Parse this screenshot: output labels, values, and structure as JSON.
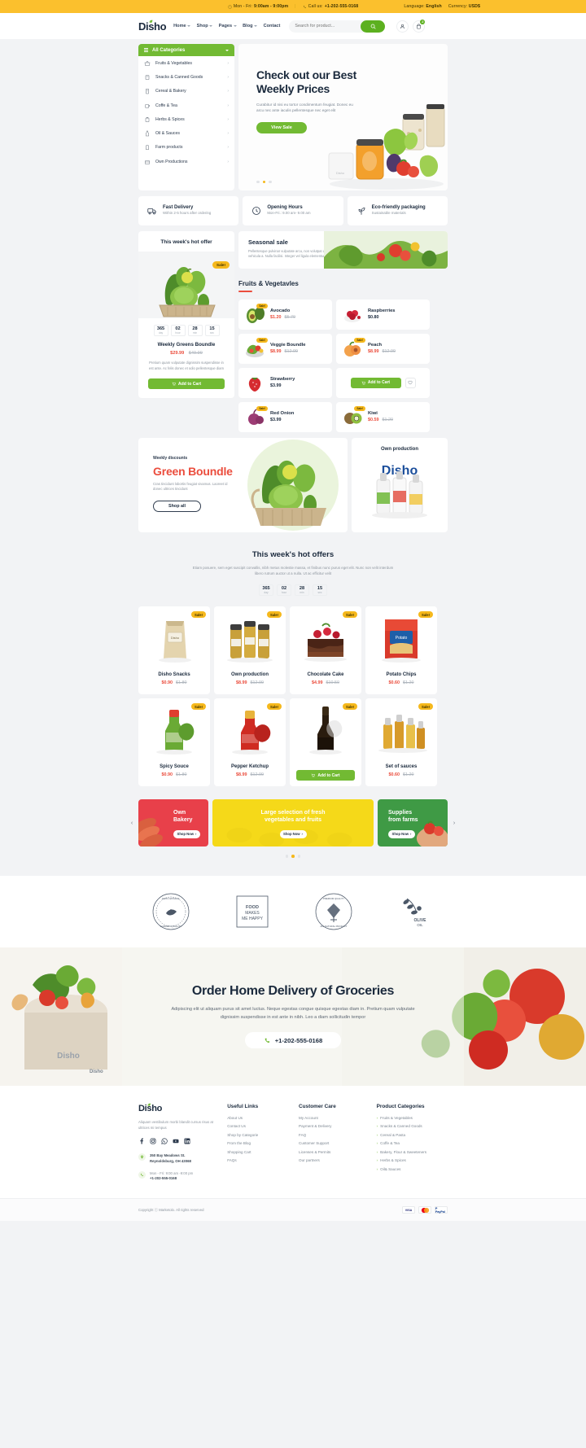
{
  "topbar": {
    "hours_label": "Mon - Fri:",
    "hours_value": "9:00am - 9:00pm",
    "call_label": "Call us:",
    "call_value": "+1-202-555-0168",
    "language_label": "Language:",
    "language_value": "English",
    "currency_label": "Currency:",
    "currency_value": "USD$"
  },
  "header": {
    "logo": "Disho",
    "nav": [
      {
        "label": "Home",
        "has_dropdown": true
      },
      {
        "label": "Shop",
        "has_dropdown": true
      },
      {
        "label": "Pages",
        "has_dropdown": true
      },
      {
        "label": "Blog",
        "has_dropdown": true
      },
      {
        "label": "Contact",
        "has_dropdown": false
      }
    ],
    "search_placeholder": "Search for product...",
    "cart_count": "2"
  },
  "categories": {
    "title": "All Categories",
    "items": [
      "Fruits & Vegetables",
      "Snacks & Canned Goods",
      "Cereal & Bakery",
      "Coffe & Tea",
      "Herbs & Spices",
      "Oil & Sauces",
      "Farm products",
      "Own Productions"
    ]
  },
  "hero": {
    "title_line1": "Check out our Best",
    "title_line2": "Weekly Prices",
    "desc": "Curabitur id nisi eu tortor condimentum feugiat. Donec eu arcu nec ante iaculis pellentesque nec eget elit",
    "button": "View Sale"
  },
  "features": [
    {
      "title": "Fast Delivery",
      "desc": "Within 2-5 hours after ordering",
      "icon": "truck-icon"
    },
    {
      "title": "Opening Hours",
      "desc": "Mon-Fri.: 9.00 am- 9.00 am",
      "icon": "clock-icon"
    },
    {
      "title": "Eco-friendly packaging",
      "desc": "Sustainable materials",
      "icon": "leaf-icon"
    }
  ],
  "hot_offer": {
    "heading": "This week's hot offer",
    "sale_badge": "Sale!",
    "timer": [
      {
        "value": "365",
        "unit": "day"
      },
      {
        "value": "02",
        "unit": "hour"
      },
      {
        "value": "28",
        "unit": "min"
      },
      {
        "value": "15",
        "unit": "sec"
      }
    ],
    "name": "Weekly Greens Boundle",
    "price_new": "$29.99",
    "price_old": "$49.99",
    "desc": "Pretium quam vulputate dignissim suspendisse in est ante. Ac felis donec et odio pellentesque diam",
    "cart_button": "Add to Cart"
  },
  "seasonal": {
    "title": "Seasonal sale",
    "desc": "Pellentesque pulvinar vulputate arcu, non volutpat dolor vehicula a. Nulla facilisi. Integer vel ligula elementum"
  },
  "fruits_section": {
    "title": "Fruits & Vegetavles",
    "products": [
      {
        "name": "Avocado",
        "price_new": "$1.20",
        "price_old": "$5.79",
        "sale": true
      },
      {
        "name": "Raspberries",
        "price_new": "$0.80",
        "price_old": "",
        "sale": false
      },
      {
        "name": "Veggie Boundle",
        "price_new": "$8.99",
        "price_old": "$12.99",
        "sale": true
      },
      {
        "name": "Peach",
        "price_new": "$8.99",
        "price_old": "$12.99",
        "sale": true
      },
      {
        "name": "Strawberry",
        "price_new": "$3.99",
        "price_old": "",
        "sale": false
      },
      {
        "name": "Red Onion",
        "price_new": "$3.99",
        "price_old": "",
        "sale": true
      },
      {
        "name": "Kiwi",
        "price_new": "$0.59",
        "price_old": "$1.20",
        "sale": true
      }
    ],
    "cart_button": "Add to Cart"
  },
  "bundle_banner": {
    "kicker": "Weekly discounts",
    "title": "Green Boundle",
    "desc": "Cras tincidunt lobortis feugiat vivamus. Laoreet id donec ultrices tincidunt",
    "button": "Shop all"
  },
  "own_production": {
    "title": "Own production",
    "brand": "Disho"
  },
  "hot_offers": {
    "title": "This week's hot offers",
    "desc": "Etiam posuere, sem eget suscipit convallis, nibh metus molestie massa, et finibus nunc purus eget elit. Nunc non velit interdum libero rutrum auctor ut a nulla. Ut ac efficitur velit",
    "timer": [
      {
        "value": "365",
        "unit": "day"
      },
      {
        "value": "02",
        "unit": "hour"
      },
      {
        "value": "28",
        "unit": "min"
      },
      {
        "value": "15",
        "unit": "sec"
      }
    ],
    "sale_badge": "Sale!",
    "cart_button": "Add to Cart",
    "products": [
      {
        "name": "Disho Snacks",
        "price_new": "$0.90",
        "price_old": "$1.80",
        "accent": "#e8c98c"
      },
      {
        "name": "Own production",
        "price_new": "$8.99",
        "price_old": "$12.99",
        "accent": "#c9a84c"
      },
      {
        "name": "Chocolate Cake",
        "price_new": "$4.99",
        "price_old": "$10.50",
        "accent": "#7a3b2a"
      },
      {
        "name": "Potato Chips",
        "price_new": "$0.60",
        "price_old": "$1.20",
        "accent": "#d93a2b"
      },
      {
        "name": "Spicy Souce",
        "price_new": "$0.90",
        "price_old": "$1.80",
        "accent": "#6aa33a"
      },
      {
        "name": "Pepper Ketchup",
        "price_new": "$8.99",
        "price_old": "$12.99",
        "accent": "#cf2b22"
      },
      {
        "name": "",
        "price_new": "",
        "price_old": "",
        "accent": "#3a2a16"
      },
      {
        "name": "Set of sauces",
        "price_new": "$0.60",
        "price_old": "$1.20",
        "accent": "#e0a932"
      }
    ]
  },
  "promos": [
    {
      "title_line1": "Own",
      "title_line2": "Bakery",
      "button": "Shop Now",
      "bg": "#e8404a"
    },
    {
      "title_line1": "Large selection of fresh",
      "title_line2": "vegetables and fruits",
      "button": "Shop Now",
      "bg": "#f5d91a"
    },
    {
      "title_line1": "Supplies",
      "title_line2": "from farms",
      "button": "Shop Now",
      "bg": "#3f9a45"
    }
  ],
  "brands": [
    "100% Natural Organic Garden Quality",
    "FOOD MAKES ME HAPPY",
    "Premium Quality All Natural Product",
    "OLIVE OIL"
  ],
  "cta": {
    "title": "Order Home Delivery of Groceries",
    "desc": "Adipiscing elit ut aliquam purus sit amet luctus. Neque egestas congue quisque egestas diam in. Pretium quam vulputate dignissim suspendisse in est ante in nibh. Leo a diam sollicitudin tempor",
    "phone": "+1-202-555-0168",
    "logo": "Disho"
  },
  "footer": {
    "logo": "Disho",
    "about": "Aliquam vestibulum morbi blandit cursus risus at ultrices mi tempus",
    "social": [
      "facebook-icon",
      "instagram-icon",
      "whatsapp-icon",
      "youtube-icon",
      "linkedin-icon"
    ],
    "address_line1": "350 Bay Meadows St.",
    "address_line2": "Reynoldsburg, OH 43068",
    "hours": "Mon - Fri: 9:00 am -9:00 pm",
    "phone": "+1-202-555-0168",
    "columns": [
      {
        "title": "Useful Links",
        "links": [
          "About Us",
          "Contact Us",
          "Shop by Categorie",
          "From the Blog",
          "Shopping Cart",
          "FAQs"
        ]
      },
      {
        "title": "Customer Care",
        "links": [
          "My Account",
          "Payment & Delivery",
          "FAQ",
          "Customer Support",
          "Licenses & Permits",
          "Our partners"
        ]
      },
      {
        "title": "Product Categories",
        "links": [
          "Fruits & Vegetables",
          "Snacks & Canned Goods",
          "Cereal & Pasta",
          "Coffe & Tea",
          "Bakery, Flour & Sweeteners",
          "Herbs & Spices",
          "Oil& Sauces"
        ],
        "bulleted": true
      }
    ],
    "copyright": "Copyright  ⓒ  Marketolo. All rights reserved",
    "payments": [
      "VISA",
      "mastercard",
      "P PayPal"
    ]
  }
}
